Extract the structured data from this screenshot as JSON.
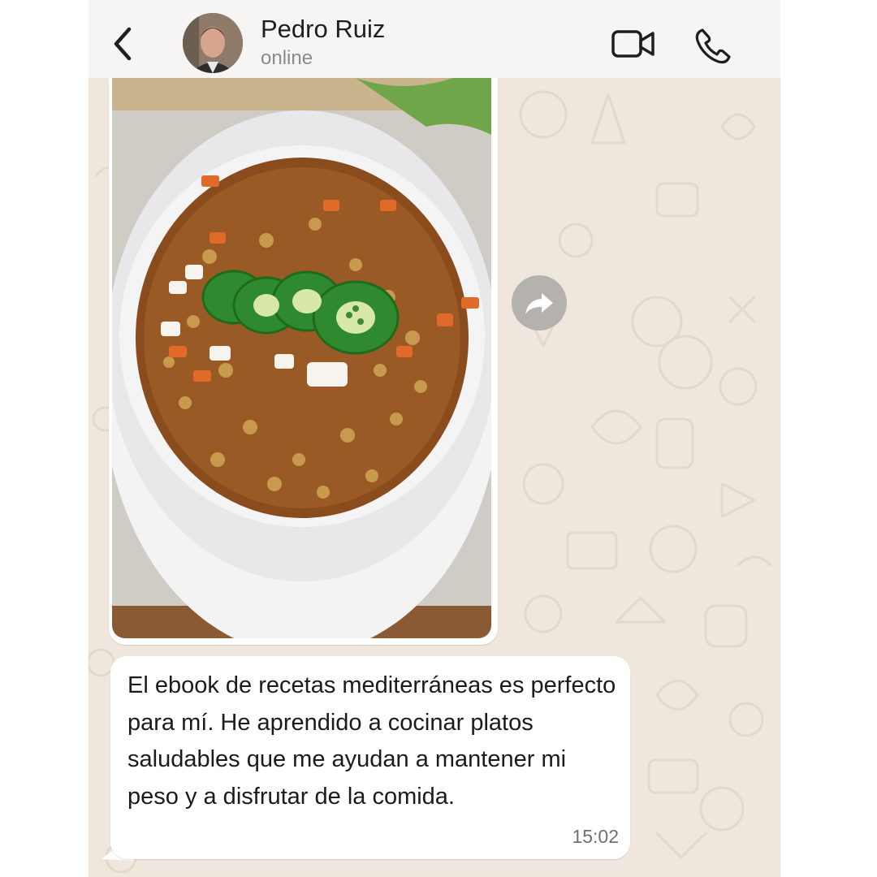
{
  "header": {
    "contact_name": "Pedro Ruiz",
    "contact_status": "online",
    "back_icon": "chevron-left-icon",
    "video_icon": "video-camera-icon",
    "call_icon": "phone-icon"
  },
  "messages": [
    {
      "type": "image",
      "image_description": "sopa de lentejas con jalapeño",
      "forward_icon": "forward-arrow-icon"
    },
    {
      "type": "text",
      "text": "El ebook de recetas mediterráneas es perfecto para mí. He aprendido a cocinar platos saludables que me ayudan a mantener mi peso y a disfrutar de la comida.",
      "time": "15:02"
    }
  ],
  "colors": {
    "header_bg": "#f6f5f3",
    "wallpaper_bg": "#efe7dd",
    "bubble_bg": "#ffffff",
    "status_text": "#8a8a8a"
  }
}
